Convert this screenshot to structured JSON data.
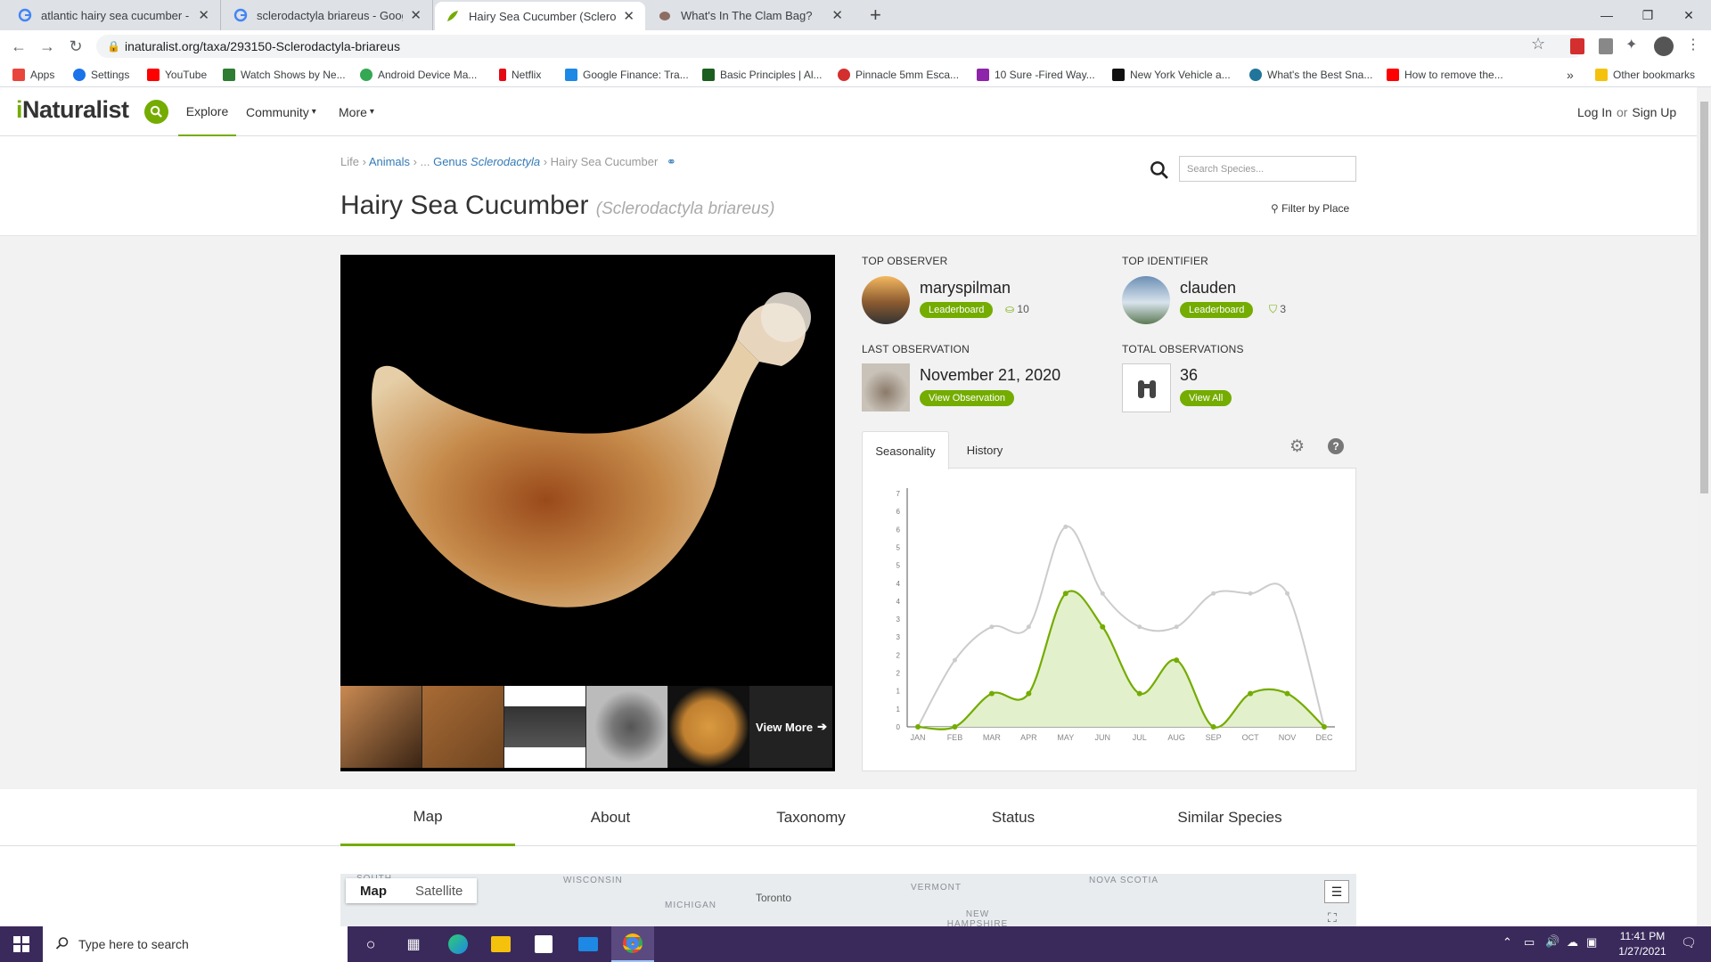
{
  "browser": {
    "tabs": [
      {
        "title": "atlantic hairy sea cucumber - Go",
        "favicon": "google-icon",
        "active": false
      },
      {
        "title": "sclerodactyla briareus - Google S",
        "favicon": "google-icon",
        "active": false
      },
      {
        "title": "Hairy Sea Cucumber (Sclerodacty",
        "favicon": "inaturalist-leaf-icon",
        "active": true
      },
      {
        "title": "What's In The Clam Bag?",
        "favicon": "clam-icon",
        "active": false
      }
    ],
    "new_tab": "+",
    "url": "inaturalist.org/taxa/293150-Sclerodactyla-briareus",
    "bookmarks": [
      {
        "label": "Apps",
        "color": "#e8453c"
      },
      {
        "label": "Settings",
        "color": "#1a73e8"
      },
      {
        "label": "YouTube",
        "color": "#ff0000"
      },
      {
        "label": "Watch Shows by Ne...",
        "color": "#2e7d32"
      },
      {
        "label": "Android Device Ma...",
        "color": "#34a853"
      },
      {
        "label": "Netflix",
        "color": "#e50914"
      },
      {
        "label": "Google Finance: Tra...",
        "color": "#1e88e5"
      },
      {
        "label": "Basic Principles | Al...",
        "color": "#1b5e20"
      },
      {
        "label": "Pinnacle 5mm Esca...",
        "color": "#d32f2f"
      },
      {
        "label": "10 Sure -Fired Way...",
        "color": "#8e24aa"
      },
      {
        "label": "New York Vehicle a...",
        "color": "#111111"
      },
      {
        "label": "What's the Best Sna...",
        "color": "#21759b"
      },
      {
        "label": "How to remove the...",
        "color": "#ff0000"
      }
    ],
    "bookmarks_more": "»",
    "other_bookmarks": "Other bookmarks"
  },
  "header": {
    "logo_i": "i",
    "logo_rest": "Naturalist",
    "nav": {
      "explore": "Explore",
      "community": "Community",
      "more": "More"
    },
    "login": "Log In",
    "or": "or",
    "signup": "Sign Up"
  },
  "taxon": {
    "breadcrumbs": {
      "life": "Life",
      "animals": "Animals",
      "ellipsis": "...",
      "genus_prefix": "Genus",
      "genus": "Sclerodactyla",
      "current": "Hairy Sea Cucumber"
    },
    "common_name": "Hairy Sea Cucumber",
    "scientific_name": "(Sclerodactyla briareus)",
    "search_placeholder": "Search Species...",
    "filter_place": "Filter by Place"
  },
  "photos": {
    "view_more": "View More"
  },
  "stats": {
    "top_observer": {
      "label": "TOP OBSERVER",
      "name": "maryspilman",
      "button": "Leaderboard",
      "count": "10"
    },
    "top_identifier": {
      "label": "TOP IDENTIFIER",
      "name": "clauden",
      "button": "Leaderboard",
      "count": "3"
    },
    "last_observation": {
      "label": "LAST OBSERVATION",
      "date": "November 21, 2020",
      "button": "View Observation"
    },
    "total_observations": {
      "label": "TOTAL OBSERVATIONS",
      "count": "36",
      "button": "View All"
    }
  },
  "chart_tabs": {
    "seasonality": "Seasonality",
    "history": "History"
  },
  "chart_data": {
    "type": "area",
    "categories": [
      "JAN",
      "FEB",
      "MAR",
      "APR",
      "MAY",
      "JUN",
      "JUL",
      "AUG",
      "SEP",
      "OCT",
      "NOV",
      "DEC"
    ],
    "yticks": [
      0,
      1,
      1,
      2,
      2,
      3,
      3,
      4,
      4,
      5,
      5,
      6,
      6,
      7
    ],
    "series": [
      {
        "values": [
          0,
          2,
          3,
          3,
          6,
          4,
          3,
          3,
          4,
          4,
          4,
          0
        ],
        "color": "#cccccc"
      },
      {
        "values": [
          0,
          0,
          1,
          1,
          4,
          3,
          1,
          2,
          0,
          1,
          1,
          0
        ],
        "color": "#74ac00"
      }
    ],
    "ylim": [
      0,
      7
    ]
  },
  "lower_tabs": [
    "Map",
    "About",
    "Taxonomy",
    "Status",
    "Similar Species"
  ],
  "map": {
    "switch": {
      "map": "Map",
      "satellite": "Satellite"
    },
    "labels": [
      "SOUTH",
      "WISCONSIN",
      "MICHIGAN",
      "Toronto",
      "VERMONT",
      "NEW HAMPSHIRE",
      "NOVA SCOTIA"
    ]
  },
  "taskbar": {
    "search_placeholder": "Type here to search",
    "time": "11:41 PM",
    "date": "1/27/2021"
  },
  "colors": {
    "accent": "#74ac00",
    "link": "#337ab7",
    "taskbar": "#3a2a5c"
  }
}
